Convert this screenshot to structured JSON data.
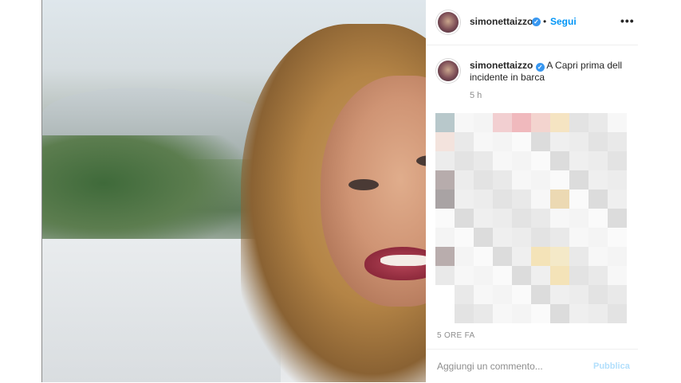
{
  "post": {
    "username": "simonettaizzo",
    "follow_label": "Segui",
    "separator": "•",
    "verified_glyph": "✓",
    "more_label": "•••",
    "caption": "A Capri prima dell incidente in barca",
    "relative_time": "5 h",
    "timestamp": "5 ORE FA"
  },
  "comment": {
    "placeholder": "Aggiungi un commento...",
    "publish_label": "Pubblica"
  },
  "icons": {
    "verified": "verified-badge-icon",
    "more": "more-options-icon"
  },
  "colors": {
    "link_blue": "#0095f6",
    "publish_disabled": "#b2dffc",
    "verified_blue": "#3897f0",
    "muted_text": "#8e8e8e"
  }
}
